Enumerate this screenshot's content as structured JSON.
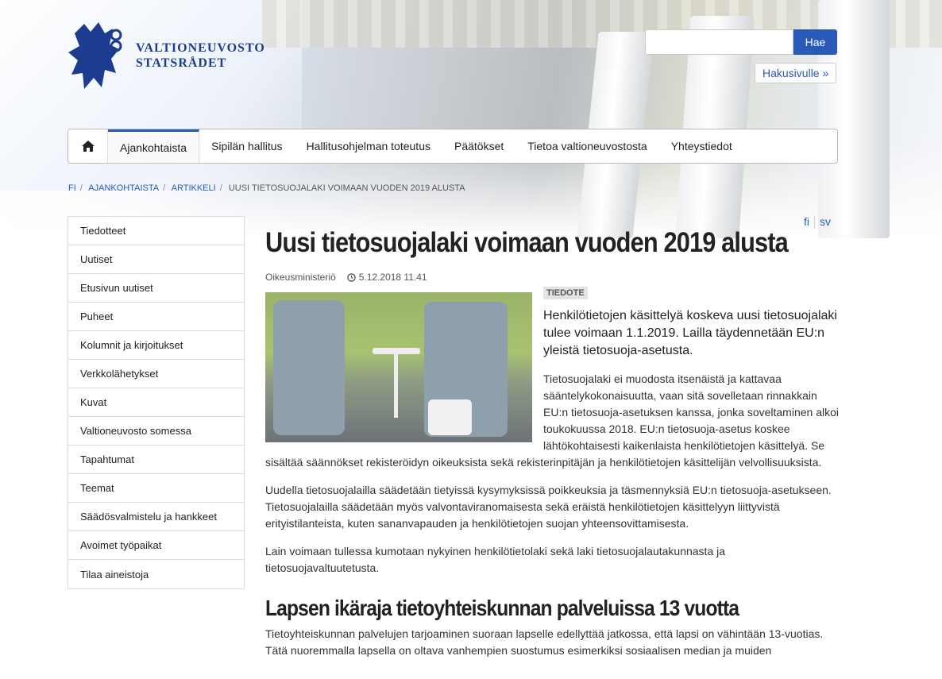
{
  "header": {
    "logo_line1": "VALTIONEUVOSTO",
    "logo_line2": "STATSRÅDET",
    "search_placeholder": "",
    "search_button": "Hae",
    "advanced_search": "Hakusivulle »"
  },
  "nav": {
    "items": [
      "Ajankohtaista",
      "Sipilän hallitus",
      "Hallitusohjelman toteutus",
      "Päätökset",
      "Tietoa valtioneuvostosta",
      "Yhteystiedot"
    ]
  },
  "breadcrumb": [
    "FI",
    "AJANKOHTAISTA",
    "ARTIKKELI",
    "UUSI TIETOSUOJALAKI VOIMAAN VUODEN 2019 ALUSTA"
  ],
  "sidebar": {
    "items": [
      "Tiedotteet",
      "Uutiset",
      "Etusivun uutiset",
      "Puheet",
      "Kolumnit ja kirjoitukset",
      "Verkkolähetykset",
      "Kuvat",
      "Valtioneuvosto somessa",
      "Tapahtumat",
      "Teemat",
      "Säädösvalmistelu ja hankkeet",
      "Avoimet työpaikat",
      "Tilaa aineistoja"
    ]
  },
  "lang": {
    "fi": "fi",
    "sv": "sv"
  },
  "article": {
    "title": "Uusi tietosuojalaki voimaan vuoden 2019 alusta",
    "ministry": "Oikeusministeriö",
    "date": "5.12.2018 11.41",
    "tag": "TIEDOTE",
    "lead": "Henkilötietojen käsittelyä koskeva uusi tietosuojalaki tulee voimaan 1.1.2019. Lailla täydennetään EU:n yleistä tietosuoja-asetusta.",
    "p1": "Tietosuojalaki ei muodosta itsenäistä ja kattavaa sääntelykokonaisuutta, vaan sitä sovelletaan rinnakkain EU:n tietosuoja-asetuksen kanssa, jonka soveltaminen alkoi toukokuussa 2018. EU:n tietosuoja-asetus koskee lähtökohtaisesti kaikenlaista henkilötietojen käsittelyä. Se sisältää säännökset rekisteröidyn oikeuksista sekä rekisterinpitäjän ja henkilötietojen käsittelijän velvollisuuksista.",
    "p2": "Uudella tietosuojalailla säädetään tietyissä kysymyksissä poikkeuksia ja täsmennyksiä EU:n tietosuoja-asetukseen. Tietosuojalailla säädetään myös valvontaviranomaisesta sekä eräistä henkilötietojen käsittelyyn liittyvistä erityistilanteista, kuten sananvapauden ja henkilötietojen suojan yhteensovittamisesta.",
    "p3": "Lain voimaan tullessa kumotaan nykyinen henkilötietolaki sekä laki tietosuojalautakunnasta ja tietosuojavaltuutetusta.",
    "h2": "Lapsen ikäraja tietoyhteiskunnan palveluissa 13 vuotta",
    "p4": "Tietoyhteiskunnan palvelujen tarjoaminen suoraan lapselle edellyttää jatkossa, että lapsi on vähintään 13-vuotias. Tätä nuoremmalla lapsella on oltava vanhempien suostumus esimerkiksi sosiaalisen median ja muiden"
  },
  "colors": {
    "accent": "#2a5ab8",
    "logo": "#1e3c8f"
  }
}
